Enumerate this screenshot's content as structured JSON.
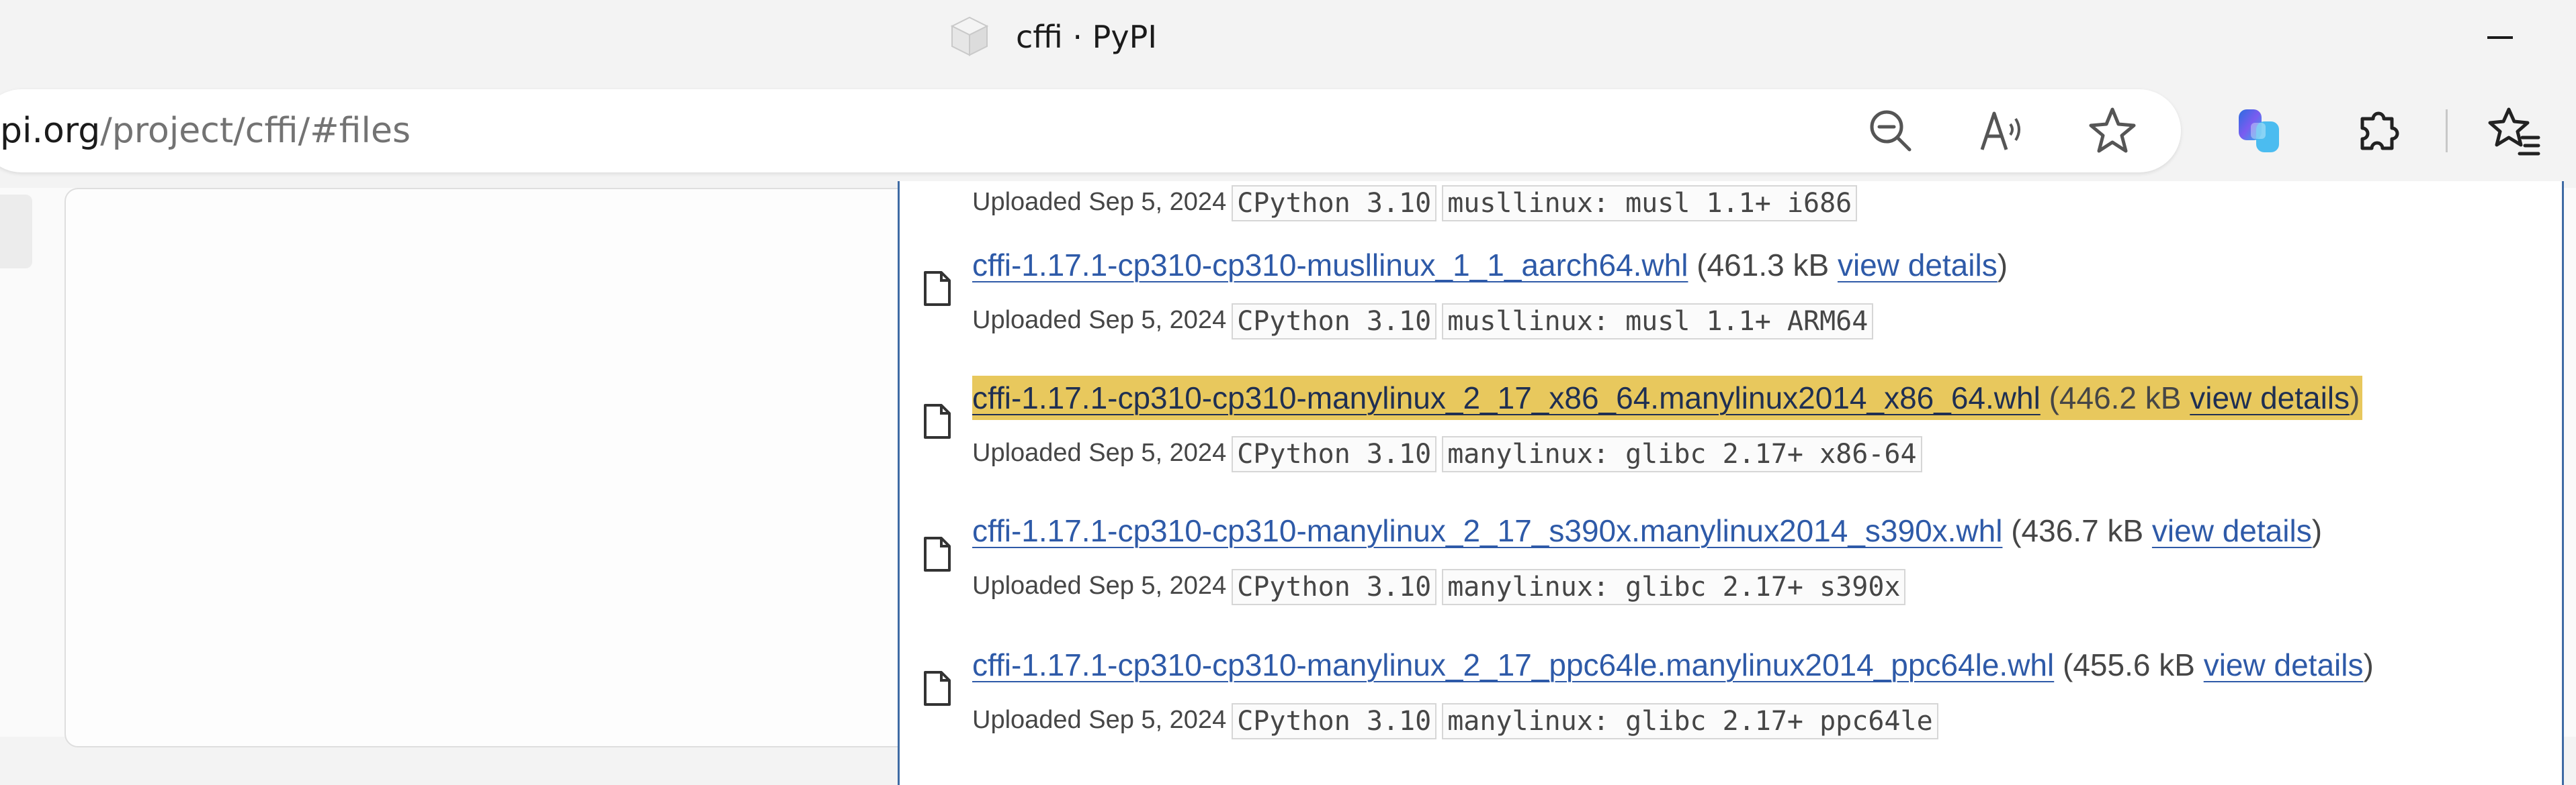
{
  "window": {
    "title": "cffi · PyPI"
  },
  "address_bar": {
    "url_host": "pi.org",
    "url_path": "/project/cffi/#files"
  },
  "icons": {
    "zoom_out": "zoom-out-icon",
    "read_aloud": "read-aloud-icon",
    "favorite": "star-icon",
    "copilot": "copilot-icon",
    "extensions": "puzzle-icon",
    "favorites": "favorites-icon"
  },
  "colors": {
    "link": "#2e5aa8",
    "highlight": "#e8c85d",
    "border_accent": "#3f6ba4"
  },
  "files": [
    {
      "uploaded": "Uploaded Sep 5, 2024",
      "tags": [
        "CPython 3.10",
        "musllinux: musl 1.1+ i686"
      ]
    },
    {
      "filename": "cffi-1.17.1-cp310-cp310-musllinux_1_1_aarch64.whl",
      "size": "(461.3 kB",
      "details": "view details",
      "close": ")",
      "uploaded": "Uploaded Sep 5, 2024",
      "tags": [
        "CPython 3.10",
        "musllinux: musl 1.1+ ARM64"
      ]
    },
    {
      "filename": "cffi-1.17.1-cp310-cp310-manylinux_2_17_x86_64.manylinux2014_x86_64.whl",
      "size": "(446.2 kB",
      "details": "view details",
      "close": ")",
      "uploaded": "Uploaded Sep 5, 2024",
      "tags": [
        "CPython 3.10",
        "manylinux: glibc 2.17+ x86-64"
      ]
    },
    {
      "filename": "cffi-1.17.1-cp310-cp310-manylinux_2_17_s390x.manylinux2014_s390x.whl",
      "size": "(436.7 kB",
      "details": "view details",
      "close": ")",
      "uploaded": "Uploaded Sep 5, 2024",
      "tags": [
        "CPython 3.10",
        "manylinux: glibc 2.17+ s390x"
      ]
    },
    {
      "filename": "cffi-1.17.1-cp310-cp310-manylinux_2_17_ppc64le.manylinux2014_ppc64le.whl",
      "size": "(455.6 kB",
      "details": "view details",
      "close": ")",
      "uploaded": "Uploaded Sep 5, 2024",
      "tags": [
        "CPython 3.10",
        "manylinux: glibc 2.17+ ppc64le"
      ]
    }
  ]
}
